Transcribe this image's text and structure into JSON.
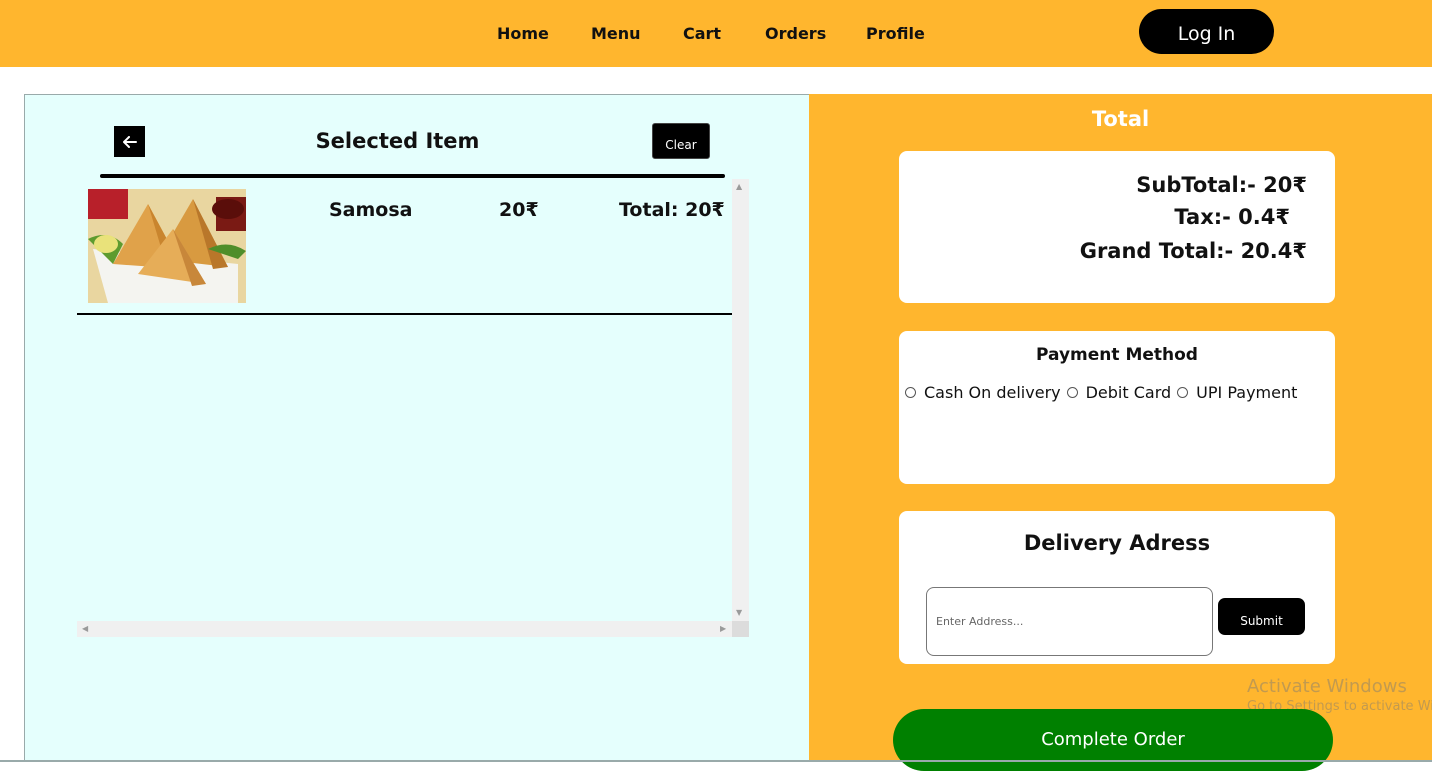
{
  "nav": {
    "items": [
      "Home",
      "Menu",
      "Cart",
      "Orders",
      "Profile"
    ],
    "login_label": "Log In"
  },
  "cart": {
    "title": "Selected Item",
    "clear_label": "Clear",
    "items": [
      {
        "name": "Samosa",
        "price": "20₹",
        "total": "Total: 20₹"
      }
    ]
  },
  "summary": {
    "heading": "Total",
    "subtotal": "SubTotal:- 20₹",
    "tax": "Tax:- 0.4₹",
    "grand_total": "Grand Total:- 20.4₹"
  },
  "payment": {
    "title": "Payment Method",
    "options": [
      "Cash On delivery",
      "Debit Card",
      "UPI Payment"
    ]
  },
  "delivery": {
    "title": "Delivery Adress",
    "placeholder": "Enter Address...",
    "submit_label": "Submit"
  },
  "complete_label": "Complete Order",
  "watermark": {
    "line1": "Activate Windows",
    "line2": "Go to Settings to activate Windows."
  },
  "colors": {
    "accent": "#FFB62E",
    "panel_bg": "#E5FFFD",
    "complete_button": "#008000"
  }
}
